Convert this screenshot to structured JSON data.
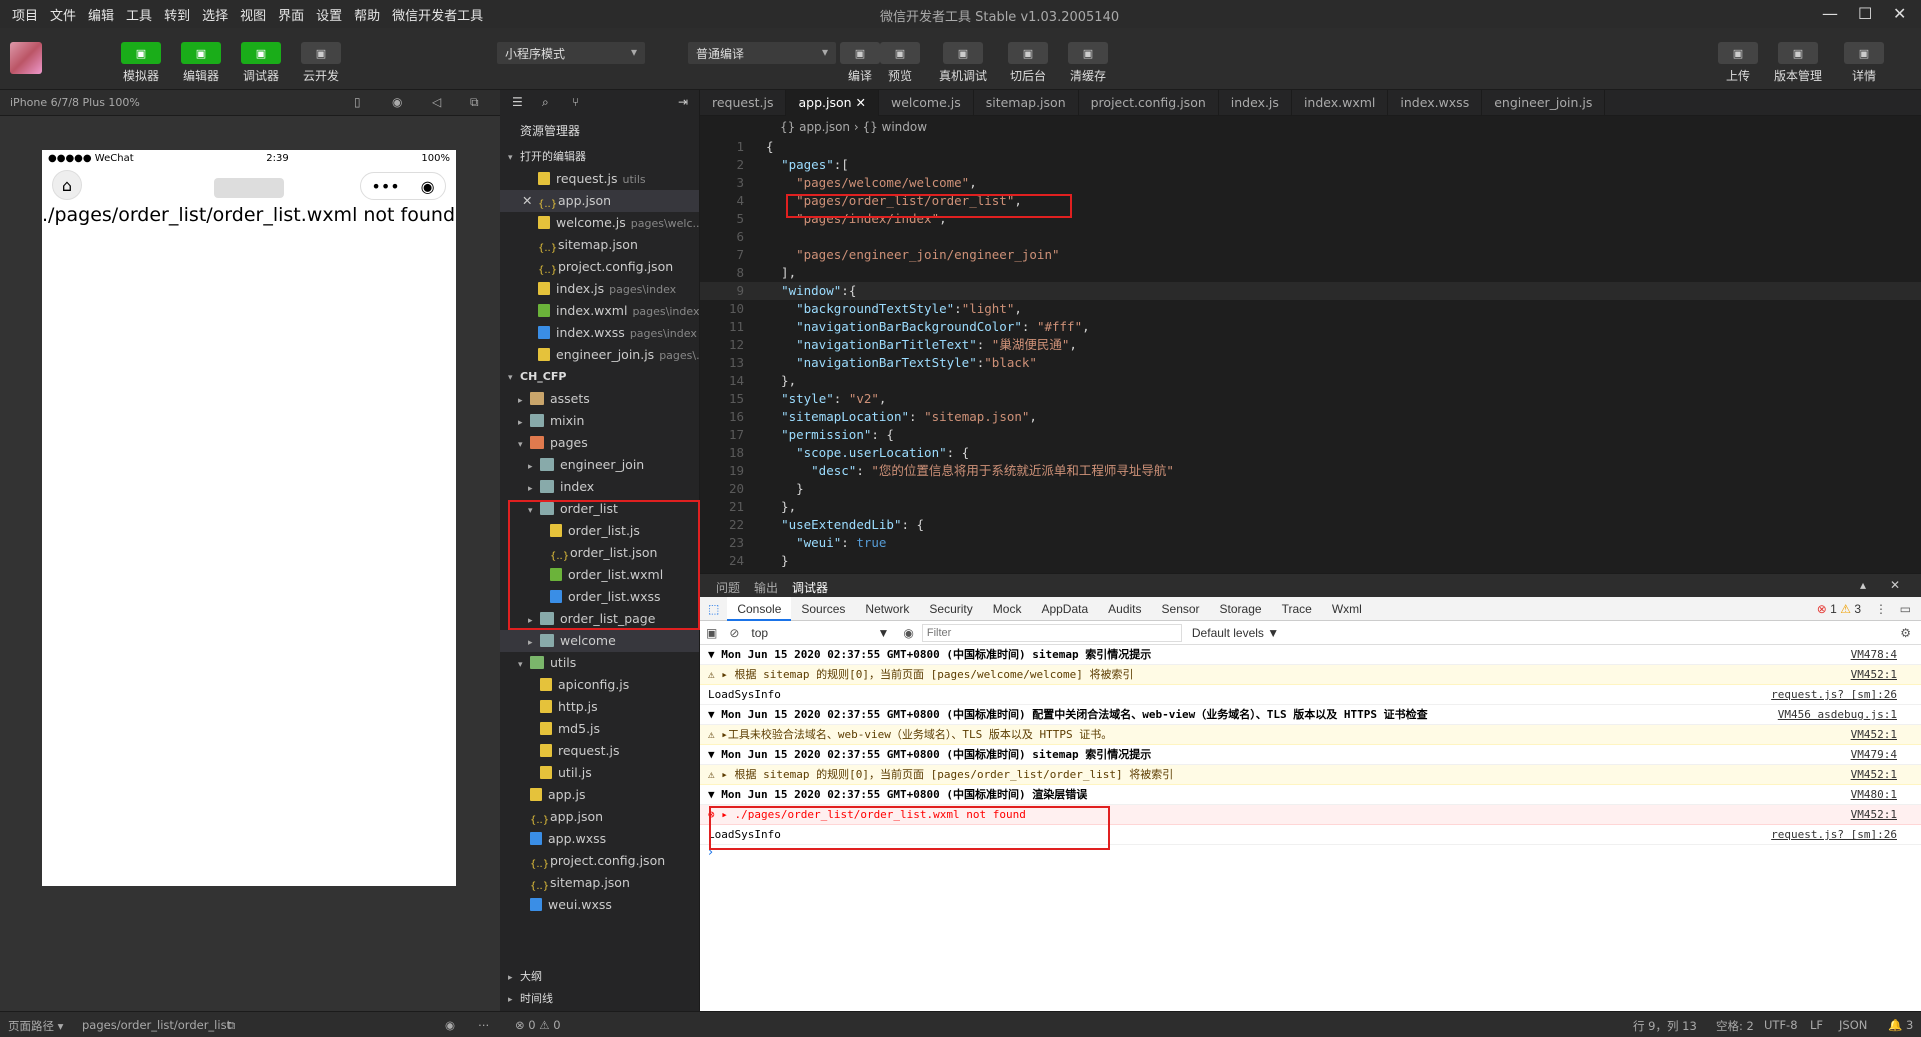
{
  "menubar": {
    "items": [
      "项目",
      "文件",
      "编辑",
      "工具",
      "转到",
      "选择",
      "视图",
      "界面",
      "设置",
      "帮助",
      "微信开发者工具"
    ],
    "title": "微信开发者工具 Stable v1.03.2005140"
  },
  "toolbar": {
    "left": [
      {
        "label": "模拟器",
        "icon": "phone-icon"
      },
      {
        "label": "编辑器",
        "icon": "code-icon"
      },
      {
        "label": "调试器",
        "icon": "debug-icon"
      },
      {
        "label": "云开发",
        "icon": "cloud-icon"
      }
    ],
    "mode_select": "小程序模式",
    "compile_select": "普通编译",
    "center": [
      {
        "label": "编译",
        "icon": "refresh-icon"
      },
      {
        "label": "预览",
        "icon": "eye-icon"
      },
      {
        "label": "真机调试",
        "icon": "bug-icon"
      },
      {
        "label": "切后台",
        "icon": "switch-icon"
      },
      {
        "label": "清缓存",
        "icon": "layers-icon"
      }
    ],
    "right": [
      {
        "label": "上传",
        "icon": "upload-icon"
      },
      {
        "label": "版本管理",
        "icon": "branch-icon"
      },
      {
        "label": "详情",
        "icon": "menu-icon"
      }
    ]
  },
  "simulator": {
    "device": "iPhone 6/7/8 Plus 100%",
    "status_carrier": "●●●●● WeChat",
    "status_time": "2:39",
    "status_battery": "100%",
    "error_text": "./pages/order_list/order_list.wxml not found"
  },
  "explorer": {
    "title": "资源管理器",
    "open_editors_title": "打开的编辑器",
    "open_editors": [
      {
        "name": "request.js",
        "hint": "utils",
        "type": "js"
      },
      {
        "name": "app.json",
        "hint": "",
        "type": "json",
        "active": true
      },
      {
        "name": "welcome.js",
        "hint": "pages\\welc...",
        "type": "js"
      },
      {
        "name": "sitemap.json",
        "hint": "",
        "type": "json"
      },
      {
        "name": "project.config.json",
        "hint": "",
        "type": "json"
      },
      {
        "name": "index.js",
        "hint": "pages\\index",
        "type": "js"
      },
      {
        "name": "index.wxml",
        "hint": "pages\\index",
        "type": "wxml"
      },
      {
        "name": "index.wxss",
        "hint": "pages\\index",
        "type": "wxss"
      },
      {
        "name": "engineer_join.js",
        "hint": "pages\\...",
        "type": "js"
      }
    ],
    "project_title": "CH_CFP",
    "tree": [
      {
        "name": "assets",
        "depth": 1,
        "type": "folder",
        "arrow": "▸"
      },
      {
        "name": "mixin",
        "depth": 1,
        "type": "folder-b",
        "arrow": "▸"
      },
      {
        "name": "pages",
        "depth": 1,
        "type": "folder-o",
        "arrow": "▾"
      },
      {
        "name": "engineer_join",
        "depth": 2,
        "type": "folder-b",
        "arrow": "▸"
      },
      {
        "name": "index",
        "depth": 2,
        "type": "folder-b",
        "arrow": "▸"
      },
      {
        "name": "order_list",
        "depth": 2,
        "type": "folder-b",
        "arrow": "▾"
      },
      {
        "name": "order_list.js",
        "depth": 3,
        "type": "js",
        "arrow": ""
      },
      {
        "name": "order_list.json",
        "depth": 3,
        "type": "json",
        "arrow": ""
      },
      {
        "name": "order_list.wxml",
        "depth": 3,
        "type": "wxml",
        "arrow": ""
      },
      {
        "name": "order_list.wxss",
        "depth": 3,
        "type": "wxss",
        "arrow": ""
      },
      {
        "name": "order_list_page",
        "depth": 2,
        "type": "folder-b",
        "arrow": "▸"
      },
      {
        "name": "welcome",
        "depth": 2,
        "type": "folder-b",
        "arrow": "▸",
        "selected": true
      },
      {
        "name": "utils",
        "depth": 1,
        "type": "folder-g",
        "arrow": "▾"
      },
      {
        "name": "apiconfig.js",
        "depth": 2,
        "type": "js",
        "arrow": ""
      },
      {
        "name": "http.js",
        "depth": 2,
        "type": "js",
        "arrow": ""
      },
      {
        "name": "md5.js",
        "depth": 2,
        "type": "js",
        "arrow": ""
      },
      {
        "name": "request.js",
        "depth": 2,
        "type": "js",
        "arrow": ""
      },
      {
        "name": "util.js",
        "depth": 2,
        "type": "js",
        "arrow": ""
      },
      {
        "name": "app.js",
        "depth": 1,
        "type": "js",
        "arrow": ""
      },
      {
        "name": "app.json",
        "depth": 1,
        "type": "json",
        "arrow": ""
      },
      {
        "name": "app.wxss",
        "depth": 1,
        "type": "wxss",
        "arrow": ""
      },
      {
        "name": "project.config.json",
        "depth": 1,
        "type": "json",
        "arrow": ""
      },
      {
        "name": "sitemap.json",
        "depth": 1,
        "type": "json",
        "arrow": ""
      },
      {
        "name": "weui.wxss",
        "depth": 1,
        "type": "wxss",
        "arrow": ""
      }
    ],
    "outline_title": "大纲",
    "timeline_title": "时间线"
  },
  "editor": {
    "tabs": [
      {
        "label": "request.js",
        "active": false
      },
      {
        "label": "app.json",
        "active": true
      },
      {
        "label": "welcome.js",
        "active": false
      },
      {
        "label": "sitemap.json",
        "active": false
      },
      {
        "label": "project.config.json",
        "active": false
      },
      {
        "label": "index.js",
        "active": false
      },
      {
        "label": "index.wxml",
        "active": false
      },
      {
        "label": "index.wxss",
        "active": false
      },
      {
        "label": "engineer_join.js",
        "active": false
      }
    ],
    "breadcrumb": "{} app.json › {} window",
    "lines": [
      "{",
      "  \"pages\":[",
      "    \"pages/welcome/welcome\",",
      "    \"pages/order_list/order_list\",",
      "    \"pages/index/index\",",
      "",
      "    \"pages/engineer_join/engineer_join\"",
      "  ],",
      "  \"window\":{",
      "    \"backgroundTextStyle\":\"light\",",
      "    \"navigationBarBackgroundColor\": \"#fff\",",
      "    \"navigationBarTitleText\": \"巢湖便民通\",",
      "    \"navigationBarTextStyle\":\"black\"",
      "  },",
      "  \"style\": \"v2\",",
      "  \"sitemapLocation\": \"sitemap.json\",",
      "  \"permission\": {",
      "    \"scope.userLocation\": {",
      "      \"desc\": \"您的位置信息将用于系统就近派单和工程师寻址导航\"",
      "    }",
      "  },",
      "  \"useExtendedLib\": {",
      "    \"weui\": true",
      "  }"
    ]
  },
  "debugger": {
    "panel_tabs": [
      "问题",
      "输出",
      "调试器"
    ],
    "tabs": [
      "Console",
      "Sources",
      "Network",
      "Security",
      "Mock",
      "AppData",
      "Audits",
      "Sensor",
      "Storage",
      "Trace",
      "Wxml"
    ],
    "context": "top",
    "filter_placeholder": "Filter",
    "levels": "Default levels ▼",
    "error_count": "1",
    "warn_count": "3",
    "logs": [
      {
        "kind": "group",
        "text": "▼ Mon Jun 15 2020 02:37:55 GMT+0800 (中国标准时间) sitemap 索引情况提示",
        "src": "VM478:4"
      },
      {
        "kind": "warn",
        "text": "⚠ ▸ 根据 sitemap 的规则[0]，当前页面 [pages/welcome/welcome] 将被索引",
        "src": "VM452:1"
      },
      {
        "kind": "info",
        "text": "  LoadSysInfo",
        "src": "request.js? [sm]:26"
      },
      {
        "kind": "group",
        "text": "▼ Mon Jun 15 2020 02:37:55 GMT+0800 (中国标准时间) 配置中关闭合法域名、web-view（业务域名）、TLS 版本以及 HTTPS 证书检查",
        "src": "VM456 asdebug.js:1"
      },
      {
        "kind": "warn",
        "text": "⚠ ▸工具未校验合法域名、web-view（业务域名）、TLS 版本以及 HTTPS 证书。",
        "src": "VM452:1"
      },
      {
        "kind": "group",
        "text": "▼ Mon Jun 15 2020 02:37:55 GMT+0800 (中国标准时间) sitemap 索引情况提示",
        "src": "VM479:4"
      },
      {
        "kind": "warn",
        "text": "⚠ ▸ 根据 sitemap 的规则[0]，当前页面 [pages/order_list/order_list] 将被索引",
        "src": "VM452:1"
      },
      {
        "kind": "group",
        "text": "▼ Mon Jun 15 2020 02:37:55 GMT+0800 (中国标准时间) 渲染层错误",
        "src": "VM480:1"
      },
      {
        "kind": "error",
        "text": "⊗ ▸ ./pages/order_list/order_list.wxml not found",
        "src": "VM452:1"
      },
      {
        "kind": "info",
        "text": "  LoadSysInfo",
        "src": "request.js? [sm]:26"
      }
    ],
    "prompt": "›"
  },
  "statusbar": {
    "page_path_label": "页面路径 ▾",
    "page_path": "pages/order_list/order_list",
    "problems": "⊗ 0 ⚠ 0",
    "cursor": "行 9，列 13",
    "spaces": "空格: 2",
    "encoding": "UTF-8",
    "eol": "LF",
    "lang": "JSON",
    "bell": "🔔 3"
  }
}
